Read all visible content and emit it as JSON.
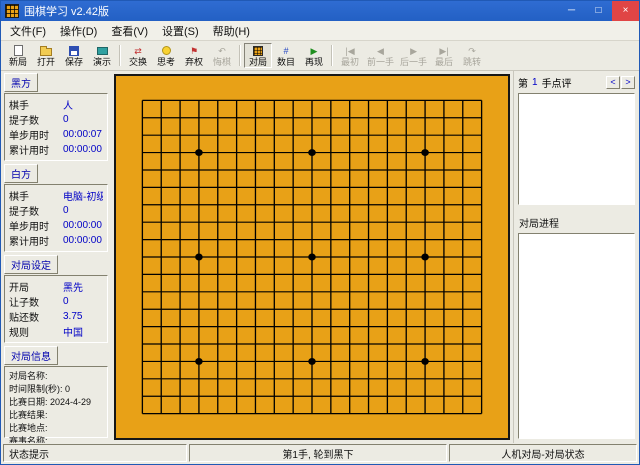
{
  "window": {
    "title": "围棋学习 v2.42版",
    "minimize": "─",
    "maximize": "□",
    "close": "×"
  },
  "menu": {
    "file": "文件(F)",
    "action": "操作(D)",
    "view": "查看(V)",
    "settings": "设置(S)",
    "help": "帮助(H)"
  },
  "toolbar": {
    "new": "新局",
    "open": "打开",
    "save": "保存",
    "demo": "演示",
    "swap": "交换",
    "think": "思考",
    "pass": "弃权",
    "undo": "悔棋",
    "play": "对局",
    "count": "数目",
    "replay": "再现",
    "first": "最初",
    "prev": "前一手",
    "next": "后一手",
    "last": "最后",
    "jump": "跳转"
  },
  "icons": {
    "swap": "⇄",
    "pass": "⚑",
    "undo": "↶",
    "count": "#",
    "replay": "▶",
    "first": "|◀",
    "prev": "◀",
    "next": "▶",
    "last": "▶|",
    "jump": "↷",
    "review_prev": "<",
    "review_next": ">"
  },
  "black": {
    "header": "黑方",
    "player_label": "棋手",
    "player": "人",
    "captures_label": "提子数",
    "captures": "0",
    "step_label": "单步用时",
    "step_time": "00:00:07",
    "total_label": "累计用时",
    "total_time": "00:00:00"
  },
  "white": {
    "header": "白方",
    "player_label": "棋手",
    "player": "电脑-初级",
    "captures_label": "提子数",
    "captures": "0",
    "step_label": "单步用时",
    "step_time": "00:00:00",
    "total_label": "累计用时",
    "total_time": "00:00:00"
  },
  "settings": {
    "header": "对局设定",
    "opening_label": "开局",
    "opening": "黑先",
    "handicap_label": "让子数",
    "handicap": "0",
    "komi_label": "贴还数",
    "komi": "3.75",
    "rules_label": "规则",
    "rules": "中国"
  },
  "info": {
    "header": "对局信息",
    "lines": [
      "对局名称:",
      "时间限制(秒): 0",
      "比赛日期: 2024-4-29",
      "比赛结果:",
      "比赛地点:",
      "赛事名称:"
    ]
  },
  "board": {
    "size": 19,
    "bg": "#E8A117",
    "line_color": "#000000",
    "stars": [
      [
        3,
        3
      ],
      [
        3,
        9
      ],
      [
        3,
        15
      ],
      [
        9,
        3
      ],
      [
        9,
        9
      ],
      [
        9,
        15
      ],
      [
        15,
        3
      ],
      [
        15,
        9
      ],
      [
        15,
        15
      ]
    ]
  },
  "review": {
    "prefix": "第",
    "move_no": "1",
    "suffix": "手点评"
  },
  "progress": {
    "header": "对局进程"
  },
  "status": {
    "left": "状态提示",
    "center": "第1手, 轮到黑下",
    "right": "人机对局-对局状态"
  }
}
